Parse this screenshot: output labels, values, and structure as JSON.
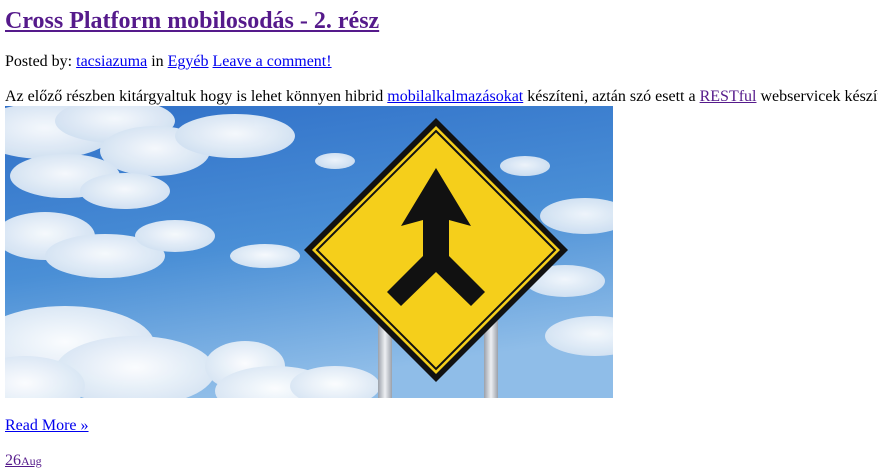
{
  "post": {
    "title": "Cross Platform mobilosodás - 2. rész",
    "meta": {
      "posted_by_label": "Posted by:",
      "author": "tacsiazuma",
      "in_label": "in",
      "category": "Egyéb",
      "comment_link": "Leave a comment!"
    },
    "excerpt": {
      "part1": "Az előző részben kitárgyaltuk hogy is lehet könnyen hibrid",
      "link1": "mobilalkalmazásokat",
      "part2": "készíteni, aztán szó esett a",
      "link2": "RESTful",
      "part3": "webservicek készít"
    },
    "image": {
      "description_icon": "merge-road-sign",
      "colors": {
        "sky": "#3f86d2",
        "sign_yellow": "#f5cf1b",
        "sign_border": "#111111",
        "post": "#c9ccd3"
      }
    },
    "read_more": "Read More »"
  },
  "next_post_date": {
    "day": "26",
    "month": "Aug"
  }
}
